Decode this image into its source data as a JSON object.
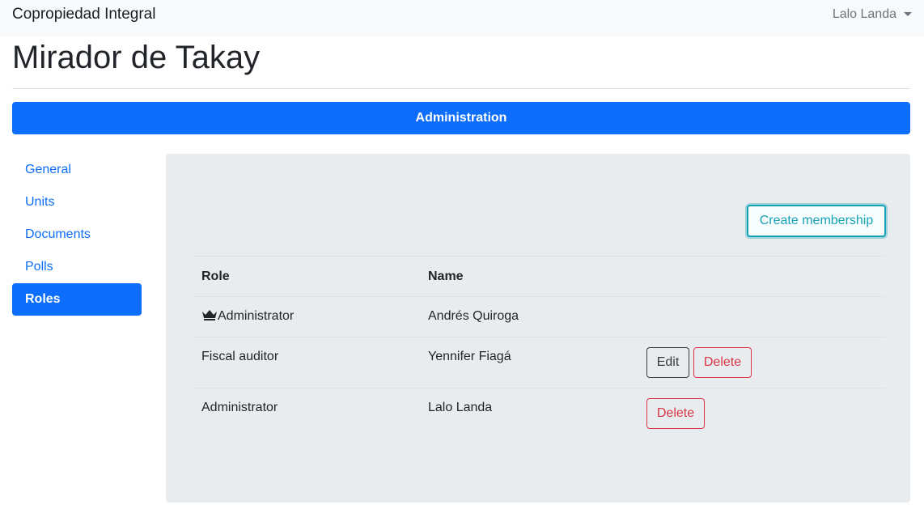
{
  "navbar": {
    "brand": "Copropiedad Integral",
    "user": "Lalo Landa"
  },
  "page": {
    "title": "Mirador de Takay",
    "section_label": "Administration"
  },
  "sidebar": {
    "items": [
      {
        "label": "General",
        "active": false
      },
      {
        "label": "Units",
        "active": false
      },
      {
        "label": "Documents",
        "active": false
      },
      {
        "label": "Polls",
        "active": false
      },
      {
        "label": "Roles",
        "active": true
      }
    ]
  },
  "panel": {
    "create_button": "Create membership",
    "columns": [
      "Role",
      "Name"
    ],
    "rows": [
      {
        "role": "Administrator",
        "name": "Andrés Quiroga",
        "icon": "crown-icon",
        "actions": []
      },
      {
        "role": "Fiscal auditor",
        "name": "Yennifer Fiagá",
        "actions": [
          "Edit",
          "Delete"
        ]
      },
      {
        "role": "Administrator",
        "name": "Lalo Landa",
        "actions": [
          "Delete"
        ]
      }
    ]
  },
  "colors": {
    "primary": "#0d6efd",
    "info": "#17a2b8",
    "danger": "#dc3545",
    "dark": "#343a40",
    "panel_bg": "#e9ecef",
    "navbar_bg": "#f8f9fa"
  }
}
